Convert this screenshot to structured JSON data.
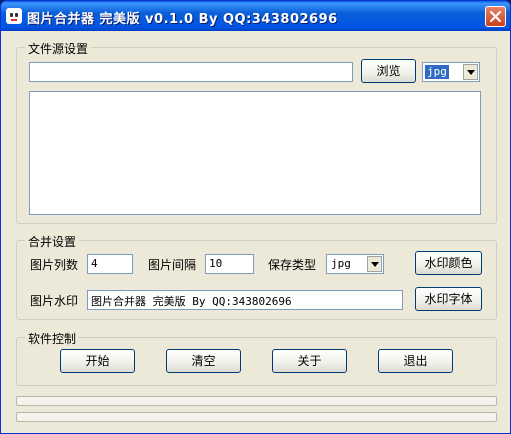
{
  "window": {
    "title": "图片合并器 完美版 v0.1.0 By QQ:343802696"
  },
  "source_group": {
    "label": "文件源设置",
    "path_value": "",
    "browse_label": "浏览",
    "type_value": "jpg"
  },
  "merge_group": {
    "label": "合并设置",
    "columns_label": "图片列数",
    "columns_value": "4",
    "spacing_label": "图片间隔",
    "spacing_value": "10",
    "save_type_label": "保存类型",
    "save_type_value": "jpg",
    "watermark_color_label": "水印颜色",
    "watermark_label": "图片水印",
    "watermark_value": "图片合并器 完美版 By QQ:343802696",
    "watermark_font_label": "水印字体"
  },
  "control_group": {
    "label": "软件控制",
    "start_label": "开始",
    "clear_label": "清空",
    "about_label": "关于",
    "exit_label": "退出"
  },
  "icons": {
    "app": "app-face-icon",
    "close": "close-icon",
    "dropdown": "chevron-down-icon"
  },
  "colors": {
    "titlebar": "#0054e3",
    "close_button": "#c8401c",
    "window_bg": "#ece9d8",
    "selection": "#316ac5"
  }
}
